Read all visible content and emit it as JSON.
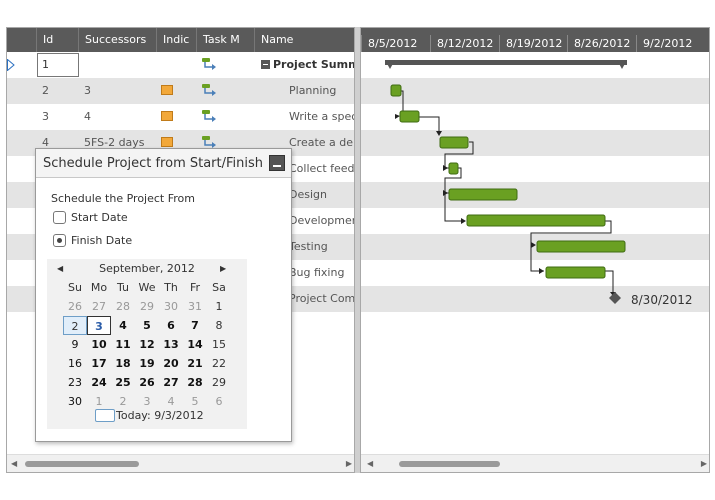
{
  "grid": {
    "columns": [
      "Id",
      "Successors",
      "Indic",
      "Task M",
      "Name"
    ],
    "rows": [
      {
        "id": "1",
        "succ": "",
        "note": false,
        "name": "Project Summary",
        "summary": true
      },
      {
        "id": "2",
        "succ": "3",
        "note": true,
        "name": "Planning",
        "summary": false
      },
      {
        "id": "3",
        "succ": "4",
        "note": true,
        "name": "Write a specification",
        "summary": false
      },
      {
        "id": "4",
        "succ": "5FS-2 days",
        "note": true,
        "name": "Create a demo",
        "summary": false
      },
      {
        "id": "",
        "succ": "",
        "note": false,
        "name": "Collect feedback",
        "summary": false
      },
      {
        "id": "",
        "succ": "",
        "note": false,
        "name": "Design",
        "summary": false
      },
      {
        "id": "",
        "succ": "",
        "note": false,
        "name": "Development",
        "summary": false
      },
      {
        "id": "",
        "succ": "",
        "note": false,
        "name": "Testing",
        "summary": false
      },
      {
        "id": "",
        "succ": "",
        "note": false,
        "name": "Bug fixing",
        "summary": false
      },
      {
        "id": "",
        "succ": "",
        "note": false,
        "name": "Project Complete",
        "summary": false
      }
    ]
  },
  "gantt": {
    "weeks": [
      "8/5/2012",
      "8/12/2012",
      "8/19/2012",
      "8/26/2012",
      "9/2/2012"
    ],
    "milestone_label": "8/30/2012",
    "colors": {
      "task": "#6aa022",
      "summary": "#555555",
      "header": "#5a5a5a"
    }
  },
  "dialog": {
    "title": "Schedule Project from Start/Finish",
    "label": "Schedule the Project From",
    "options": [
      "Start Date",
      "Finish Date"
    ],
    "selected": "Finish Date",
    "calendar": {
      "month": "September, 2012",
      "days_of_week": [
        "Su",
        "Mo",
        "Tu",
        "We",
        "Th",
        "Fr",
        "Sa"
      ],
      "weeks": [
        [
          "26",
          "27",
          "28",
          "29",
          "30",
          "31",
          "1"
        ],
        [
          "2",
          "3",
          "4",
          "5",
          "6",
          "7",
          "8"
        ],
        [
          "9",
          "10",
          "11",
          "12",
          "13",
          "14",
          "15"
        ],
        [
          "16",
          "17",
          "18",
          "19",
          "20",
          "21",
          "22"
        ],
        [
          "23",
          "24",
          "25",
          "26",
          "27",
          "28",
          "29"
        ],
        [
          "30",
          "1",
          "2",
          "3",
          "4",
          "5",
          "6"
        ]
      ],
      "today_day": "2",
      "selected_day": "3",
      "today_label": "Today: 9/3/2012"
    }
  },
  "icons": [
    "play-arrow-icon",
    "note-icon",
    "task-mode-icon",
    "collapse-icon",
    "minimize-icon",
    "chevron-left-icon",
    "chevron-right-icon"
  ]
}
